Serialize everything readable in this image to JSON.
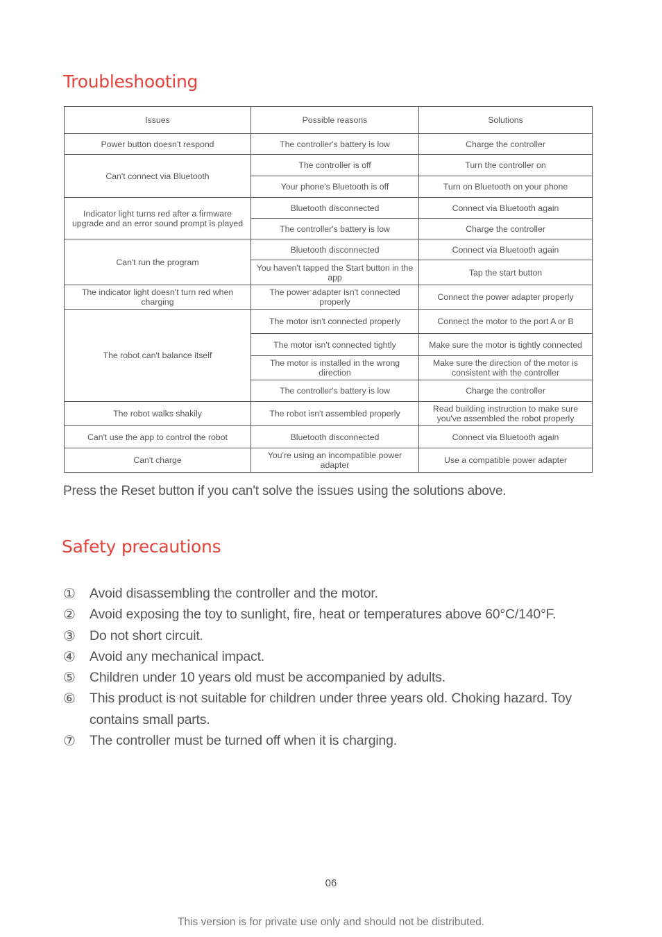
{
  "troubleshooting": {
    "title": "Troubleshooting",
    "headers": [
      "Issues",
      "Possible reasons",
      "Solutions"
    ],
    "groups": [
      {
        "issue": "Power button doesn't respond",
        "rows": [
          {
            "reason": "The controller's battery is low",
            "solution": "Charge the controller"
          }
        ]
      },
      {
        "issue": "Can't connect via Bluetooth",
        "rows": [
          {
            "reason": "The controller is off",
            "solution": "Turn the controller on"
          },
          {
            "reason": "Your phone's Bluetooth is off",
            "solution": "Turn on Bluetooth on your phone"
          }
        ]
      },
      {
        "issue": "Indicator light turns red after a firmware upgrade and an error sound prompt is played",
        "rows": [
          {
            "reason": "Bluetooth disconnected",
            "solution": "Connect via Bluetooth again"
          },
          {
            "reason": "The controller's battery is low",
            "solution": "Charge the controller"
          }
        ]
      },
      {
        "issue": "Can't run the program",
        "rows": [
          {
            "reason": "Bluetooth disconnected",
            "solution": "Connect via Bluetooth again"
          },
          {
            "reason": "You haven't tapped the Start button in the app",
            "solution": "Tap the start button"
          }
        ]
      },
      {
        "issue": "The indicator light doesn't turn red when charging",
        "rows": [
          {
            "reason": "The power adapter isn't connected properly",
            "solution": "Connect the power adapter properly"
          }
        ]
      },
      {
        "issue": "The robot can't balance itself",
        "rows": [
          {
            "reason": "The motor isn't connected properly",
            "solution": "Connect the motor to the port A or B"
          },
          {
            "reason": "The motor isn't connected tightly",
            "solution": "Make sure the motor is tightly connected"
          },
          {
            "reason": "The motor is installed in the wrong direction",
            "solution": "Make sure the direction of the motor is consistent with the controller"
          },
          {
            "reason": "The controller's battery is low",
            "solution": "Charge the controller"
          }
        ]
      },
      {
        "issue": "The robot walks shakily",
        "rows": [
          {
            "reason": "The robot isn't assembled properly",
            "solution": "Read building instruction to make sure you've assembled the robot properly"
          }
        ]
      },
      {
        "issue": "Can't use the app to control the robot",
        "rows": [
          {
            "reason": "Bluetooth disconnected",
            "solution": "Connect via Bluetooth again"
          }
        ]
      },
      {
        "issue": "Can't charge",
        "rows": [
          {
            "reason": "You're using an incompatible power adapter",
            "solution": "Use a compatible power adapter"
          }
        ]
      }
    ],
    "reset_note": "Press the Reset button if you can't solve the issues using the solutions above."
  },
  "safety": {
    "title": "Safety precautions",
    "items": [
      {
        "num": "①",
        "text": "Avoid disassembling the controller and the motor."
      },
      {
        "num": "②",
        "text": "Avoid exposing the toy to sunlight, fire, heat or temperatures above 60°C/140°F."
      },
      {
        "num": "③",
        "text": "Do not short circuit."
      },
      {
        "num": "④",
        "text": "Avoid any mechanical impact."
      },
      {
        "num": "⑤",
        "text": "Children under 10 years old must be accompanied by adults."
      },
      {
        "num": "⑥",
        "text": "This product is not suitable for children under three years old. Choking hazard. Toy contains small parts."
      },
      {
        "num": "⑦",
        "text": "The controller must be turned off when it is charging."
      }
    ]
  },
  "footer": {
    "page_number": "06",
    "note": "This version is for private use only and should not be distributed."
  },
  "colors": {
    "accent": "#e4433a",
    "text": "#555555",
    "border": "#555555"
  }
}
